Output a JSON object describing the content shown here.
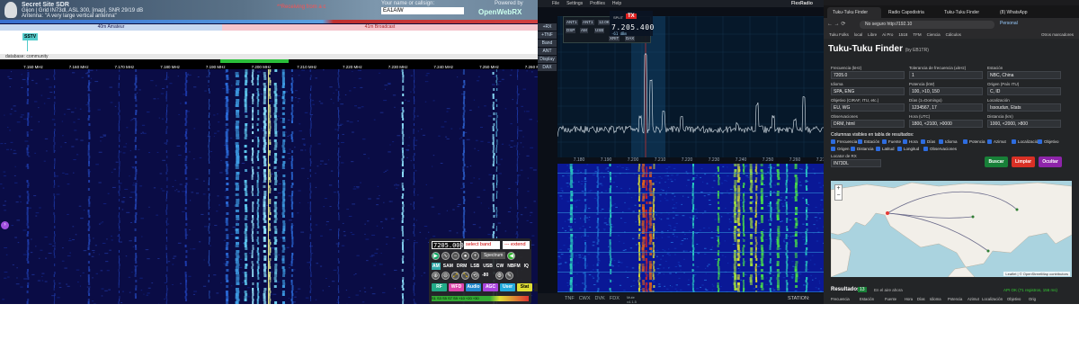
{
  "openwebrx": {
    "site_title": "Secret Site SDR",
    "location_line": "Gijon | Grid IN73dl, ASL 300, [map], SNR 29/19 dB",
    "antenna_line": "Antenna: \"A very large vertical antenna\"",
    "receiving_text": "**Receiving from a c",
    "callsign_label": "Your name or callsign:",
    "callsign_value": "EA1AIW",
    "powered_by": "Powered by",
    "powered_name": "OpenWebRX",
    "band_left": "40m Amateur",
    "band_right": "41m Broadcast",
    "bookmark": "SSTV",
    "database_label": "database: community",
    "scale_ticks": [
      "7.150 MHz",
      "7.160 MHz",
      "7.170 MHz",
      "7.180 MHz",
      "7.190 MHz",
      "7.200 MHz",
      "7.210 MHz",
      "7.220 MHz",
      "7.230 MHz",
      "7.240 MHz",
      "7.250 MHz",
      "7.260 MHz",
      "7.27"
    ],
    "panel": {
      "frequency": "7205.000",
      "select_band": "select band",
      "bookmark_sel": "--- extend",
      "spectrum_label": "Spectrum",
      "modes": [
        "AM",
        "SAM",
        "DRM",
        "LSB",
        "USB",
        "CW",
        "NBFM",
        "IQ"
      ],
      "buttons": [
        "RF",
        "WFD",
        "Audio",
        "AGC",
        "User",
        "Stat",
        "Off"
      ],
      "zoom_text": "-80",
      "smeter_scale": "S1  S3  S5  S7  S9  +10  +20  +30"
    }
  },
  "smartsdr": {
    "menu": [
      "File",
      "Settings",
      "Profiles",
      "Help"
    ],
    "brand": "FlexRadio",
    "side_buttons": [
      "+RX",
      "+TNF",
      "Band",
      "ANT",
      "Display",
      "DAX"
    ],
    "vfo_buttons": [
      "ANT1",
      "ANT1",
      "12.0K",
      "DSP",
      "AM",
      "USB",
      "XRIT",
      "DAX"
    ],
    "split": "SPLIT",
    "tx": "TX",
    "frequency": "7.205.400",
    "db_label": "-61 dBm",
    "scale_ticks": [
      "7.180",
      "7.190",
      "7.200",
      "7.210",
      "7.220",
      "7.230",
      "7.240",
      "7.250",
      "7.260",
      "7.270"
    ],
    "status_items": [
      "TNF",
      "CWX",
      "DVK",
      "FDX"
    ],
    "status_mid": "Mute\nv4.1.5",
    "station": "STATION: GIJON"
  },
  "browser": {
    "tabs": [
      "Tuku-Tuku Finder",
      "Radio Capodistria",
      "Tuku-Tuku Finder",
      "(8) WhatsApp"
    ],
    "url": "No seguro   http://192.10",
    "profile": "Personal",
    "bookmarks": [
      "Tuku Folks",
      "local",
      "Libre",
      "Ai Pro",
      "1518",
      "TFM",
      "Ciencia",
      "Cálculos"
    ],
    "other_bookmarks": "Otros marcadores",
    "title": "Tuku-Tuku Finder",
    "by": "(by EB1TR)",
    "fields": [
      {
        "label": "Frecuencia (kHz)",
        "value": "7205.0"
      },
      {
        "label": "Tolerancia de frecuencia (±kHz)",
        "value": "1"
      },
      {
        "label": "Estación",
        "value": "NBC, China"
      },
      {
        "label": "Idioma",
        "value": "SPA, ENG"
      },
      {
        "label": "Potencia (kW)",
        "value": "100, >10, 150"
      },
      {
        "label": "Origen (País ITU)",
        "value": "C, ID"
      },
      {
        "label": "Objetivo (CIRAF, ITU, etc.)",
        "value": "EU, WG"
      },
      {
        "label": "Días (1=Domingo)",
        "value": "1234567, 17"
      },
      {
        "label": "Localización",
        "value": "Issoudun, Etats"
      },
      {
        "label": "Observaciones",
        "value": "DRM, html"
      },
      {
        "label": "Hora (UTC)",
        "value": "1800, <2100, >0000"
      },
      {
        "label": "Distancia (km)",
        "value": "1000, <2000, >800"
      }
    ],
    "columns_title": "Columnas visibles en tabla de resultados:",
    "columns": [
      "Frecuencia",
      "Estación",
      "Fuente",
      "Hora",
      "Días",
      "Idioma",
      "Potencia",
      "Azimut",
      "Localización",
      "Objetivo",
      "Origen",
      "Distancia",
      "Latitud",
      "Longitud",
      "Observaciones"
    ],
    "locator_label": "Locator de RX",
    "locator_value": "IN73DL",
    "btn_search": "Buscar",
    "btn_clear": "Limpiar",
    "btn_hide": "Ocultar",
    "btn_colors": {
      "search": "#188038",
      "clear": "#d93025",
      "hide": "#8e24aa"
    },
    "map_credit": "Leaflet | © OpenStreetMap contributors",
    "zoom_in": "+",
    "zoom_out": "−",
    "results_title": "Resultados",
    "results_count": "13",
    "results_auto": "En el aire ahora",
    "results_ok": "API OK (71 registros, 156 ms)",
    "results_headers": [
      "Frecuencia",
      "Estación",
      "Fuente",
      "Hora",
      "Días",
      "Idioma",
      "Potencia",
      "Azimut",
      "Localización",
      "Objetivo",
      "Orig"
    ]
  }
}
